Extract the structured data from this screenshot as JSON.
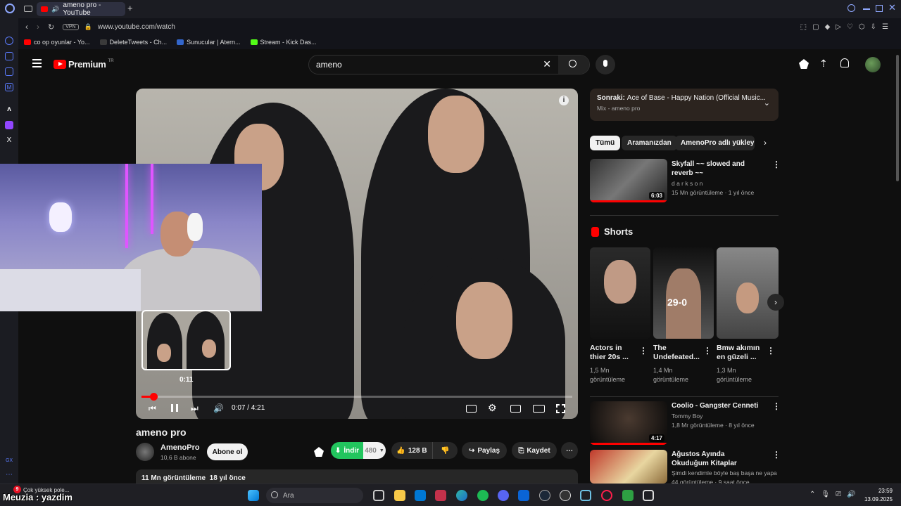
{
  "browser": {
    "tab_title": "ameno pro - YouTube",
    "vpn_label": "VPN",
    "url": "www.youtube.com/watch",
    "bookmarks": [
      {
        "label": "co op oyunlar - Yo...",
        "color": "#ff0000"
      },
      {
        "label": "DeleteTweets - Ch...",
        "color": "#3a3a3a"
      },
      {
        "label": "Sunucular | Atern...",
        "color": "#3366cc"
      },
      {
        "label": "Stream - Kick Das...",
        "color": "#53fc18"
      }
    ]
  },
  "youtube": {
    "logo_text": "Premium",
    "region": "TR",
    "search_query": "ameno"
  },
  "video": {
    "preview_time": "0:11",
    "time_display": "0:07 / 4:21",
    "progress_fraction": 0.027,
    "title": "ameno pro",
    "channel": "AmenoPro",
    "subscribers": "10,6 B abone",
    "subscribe_label": "Abone ol",
    "download_label": "İndir",
    "quality": "480",
    "likes": "128 B",
    "share_label": "Paylaş",
    "save_label": "Kaydet",
    "views_date": "11 Mn görüntüleme  18 yıl önce"
  },
  "upnext": {
    "label": "Sonraki:",
    "title": "Ace of Base - Happy Nation (Official Music...",
    "subtitle": "Mix - ameno pro"
  },
  "chips": [
    "Tümü",
    "Aramanızdan",
    "AmenoPro adlı yükleyici"
  ],
  "recommended_top": {
    "title": "Skyfall ~~ slowed and reverb ~~",
    "channel": "d a r k s o n",
    "meta": "15 Mn görüntüleme · 1 yıl önce",
    "duration": "6:03"
  },
  "shorts": {
    "heading": "Shorts",
    "items": [
      {
        "title": "Actors in thier 20s ...",
        "views": "1,5 Mn",
        "views_label": "görüntüleme"
      },
      {
        "title": "The Undefeated...",
        "views": "1,4 Mn",
        "views_label": "görüntüleme",
        "overlay": "29-0"
      },
      {
        "title": "Bmw akımın en güzeli ...",
        "views": "1,3 Mn",
        "views_label": "görüntüleme"
      }
    ]
  },
  "recommended": [
    {
      "title": "Coolio - Gangster Cenneti",
      "channel": "Tommy Boy",
      "meta": "1,8 Mr görüntüleme · 8 yıl önce",
      "duration": "4:17"
    },
    {
      "title": "Ağustos Ayında Okuduğum Kitaplar",
      "channel": "Şimdi kendimle böyle baş başa ne yapac...",
      "meta": "44 görüntüleme · 9 saat önce",
      "duration": ""
    }
  ],
  "overlay": {
    "stream_user": "Meuzia : yazdim",
    "notification": "Çok yüksek pole..."
  },
  "taskbar": {
    "search_placeholder": "Ara",
    "time": "23:59",
    "date": "13.09.2025",
    "badge_count": "9"
  },
  "colors": {
    "accent": "#ff0000",
    "download": "#22c55e",
    "upnext_bg": "#2c241f"
  }
}
